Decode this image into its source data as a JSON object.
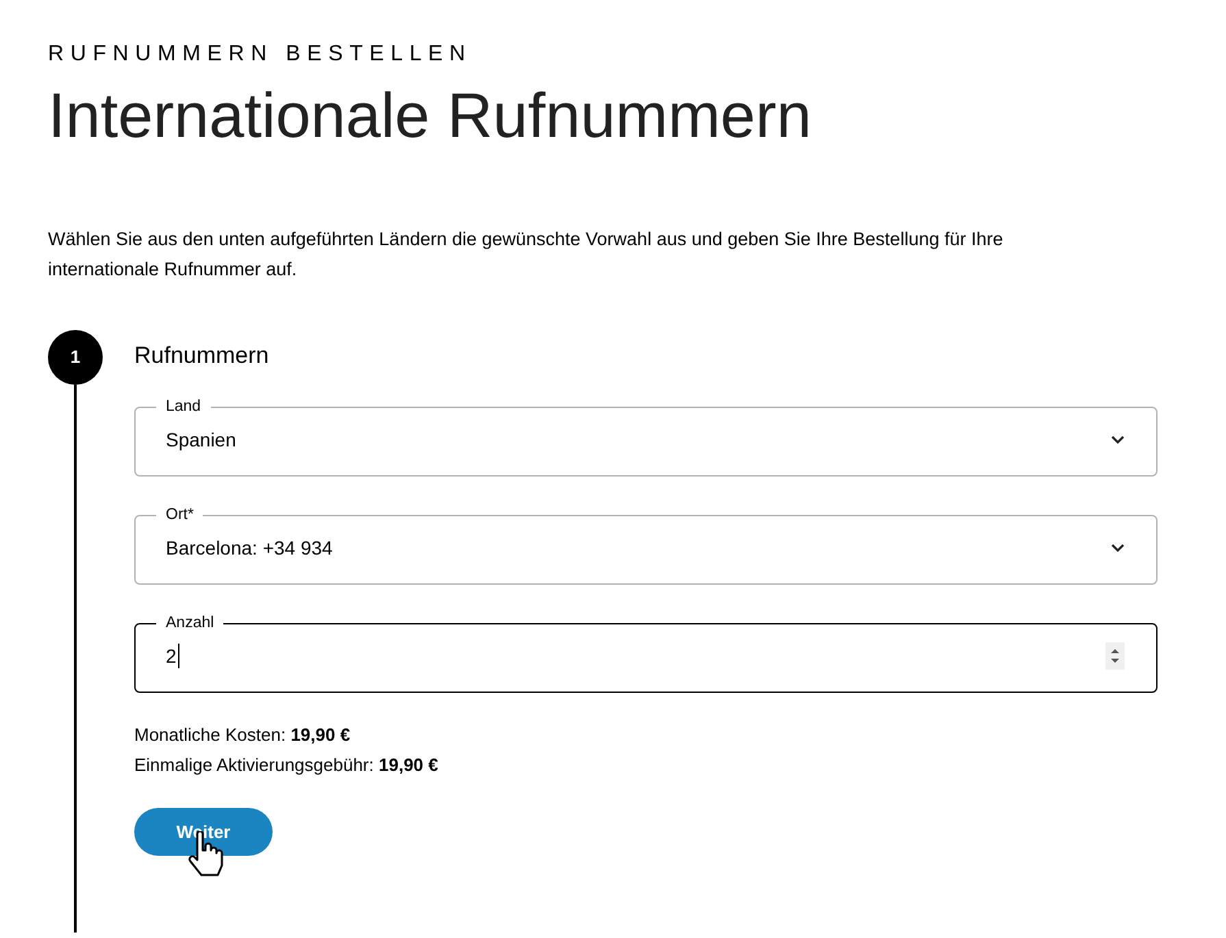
{
  "eyebrow": "RUFNUMMERN BESTELLEN",
  "title": "Internationale Rufnummern",
  "intro": "Wählen Sie aus den unten aufgeführten Ländern die gewünschte Vorwahl aus und geben Sie Ihre Bestellung für Ihre internationale Rufnummer auf.",
  "step": {
    "number": "1",
    "title": "Rufnummern",
    "fields": [
      {
        "kind": "select",
        "label": "Land",
        "value": "Spanien",
        "focused": false
      },
      {
        "kind": "select",
        "label": "Ort*",
        "value": "Barcelona: +34 934",
        "focused": false
      },
      {
        "kind": "number",
        "label": "Anzahl",
        "value": "2",
        "focused": true
      }
    ],
    "costs": [
      "Monatliche Kosten: **19,90 €**",
      "Einmalige Aktivierungsgebühr: **19,90 €**"
    ],
    "button": "Weiter"
  }
}
